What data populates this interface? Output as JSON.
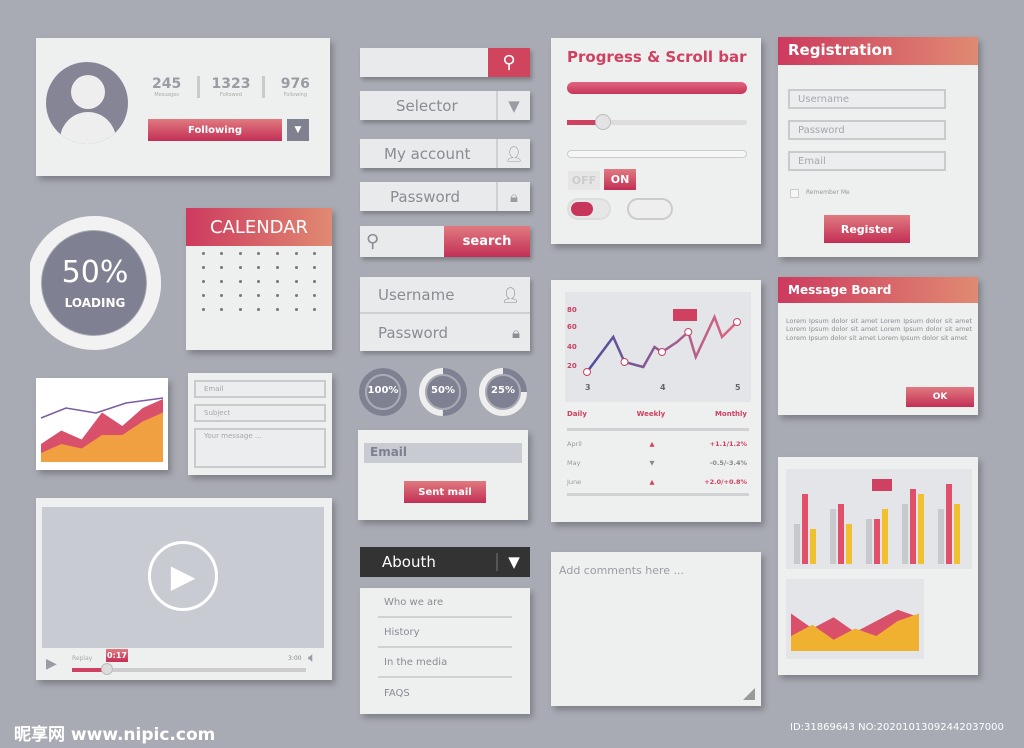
{
  "profile": {
    "stats": [
      {
        "value": "245",
        "label": "Messages"
      },
      {
        "value": "1323",
        "label": "Followed"
      },
      {
        "value": "976",
        "label": "Following"
      }
    ],
    "follow_button": "Following"
  },
  "loading": {
    "percent": 50,
    "percent_label": "50%",
    "label": "LOADING"
  },
  "calendar": {
    "title": "CALENDAR"
  },
  "contact_form": {
    "email_placeholder": "Email",
    "subject_placeholder": "Subject",
    "message_placeholder": "Your message ..."
  },
  "video": {
    "time_tooltip": "0:17",
    "left_label": "Replay",
    "right_label": "3:00",
    "progress": 0.15
  },
  "controls": {
    "selector": "Selector",
    "my_account": "My account",
    "password": "Password",
    "search_button": "search",
    "login_username": "Username",
    "login_password": "Password"
  },
  "circles": [
    {
      "label": "100%",
      "value": 100
    },
    {
      "label": "50%",
      "value": 50
    },
    {
      "label": "25%",
      "value": 25
    }
  ],
  "email_box": {
    "placeholder": "Email",
    "button": "Sent mail"
  },
  "about_menu": {
    "title": "Abouth",
    "items": [
      "Who we are",
      "History",
      "In the media",
      "FAQS"
    ]
  },
  "progress_panel": {
    "title": "Progress & Scroll bar",
    "slider_value": 0.2,
    "toggle_off": "OFF",
    "toggle_on": "ON"
  },
  "stats_table": {
    "headers": [
      "Daily",
      "Weekly",
      "Monthly"
    ],
    "rows": [
      {
        "month": "April",
        "trend": "up",
        "change": "+1.1/1.2%"
      },
      {
        "month": "May",
        "trend": "down",
        "change": "-0.5/-3.4%"
      },
      {
        "month": "June",
        "trend": "up",
        "change": "+2.0/+0.8%"
      }
    ]
  },
  "comments": {
    "placeholder": "Add comments here ..."
  },
  "registration": {
    "title": "Registration",
    "username": "Username",
    "password": "Password",
    "email": "Email",
    "remember": "Remember Me",
    "button": "Register"
  },
  "message_board": {
    "title": "Message Board",
    "text": "Lorem Ipsum dolor sit amet Lorem Ipsum dolor sit amet Lorem Ipsum dolor sit amet Lorem Ipsum dolor sit amet Lorem Ipsum dolor sit amet Lorem Ipsum dolor sit amet",
    "button": "OK"
  },
  "watermark": {
    "site": "昵享网 www.nipic.com",
    "id": "ID:31869643 NO:20201013092442037000"
  },
  "colors": {
    "accent": "#cd3a5e",
    "accent2": "#e08a72",
    "gray": "#8a8c94",
    "yellow": "#f0c030"
  },
  "chart_data": [
    {
      "type": "line",
      "y_tick_labels": [
        "80",
        "60",
        "40",
        "20"
      ],
      "x_tick_labels": [
        "3",
        "4",
        "5"
      ],
      "ylim": [
        10,
        90
      ],
      "x": [
        3,
        3.35,
        3.5,
        3.75,
        3.9,
        4,
        4.2,
        4.35,
        4.45,
        4.7,
        4.8,
        5
      ],
      "values": [
        20,
        55,
        30,
        25,
        45,
        40,
        50,
        60,
        35,
        75,
        55,
        70
      ]
    },
    {
      "type": "bar",
      "series": [
        {
          "color": "#c8c9cc",
          "values": [
            40,
            55,
            45,
            60,
            55
          ]
        },
        {
          "color": "#e0506a",
          "values": [
            70,
            60,
            45,
            75,
            80
          ]
        },
        {
          "color": "#f0c030",
          "values": [
            35,
            40,
            55,
            70,
            60
          ]
        }
      ]
    },
    {
      "type": "area",
      "values": [
        [
          20,
          35,
          25,
          55,
          40,
          60,
          70
        ],
        [
          10,
          20,
          15,
          30,
          30,
          45,
          55
        ]
      ]
    }
  ]
}
